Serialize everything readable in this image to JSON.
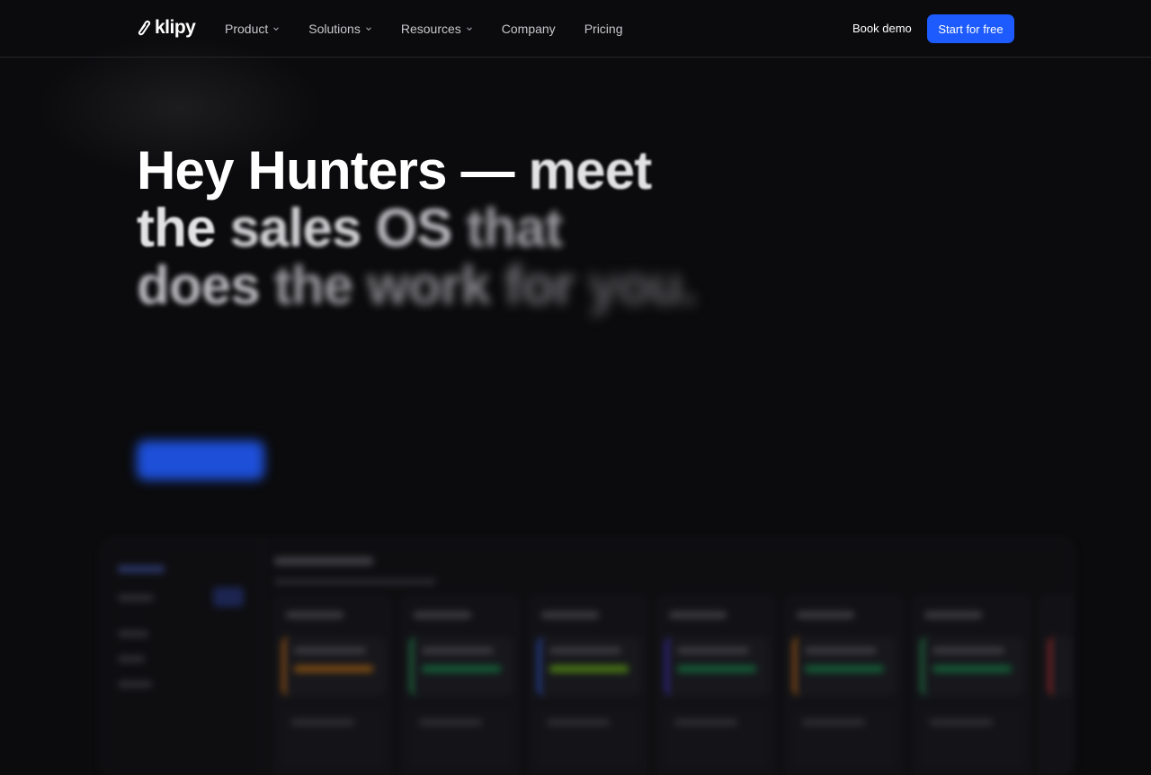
{
  "nav": {
    "logo_text": "klipy",
    "menu": [
      {
        "label": "Product",
        "has_dropdown": true
      },
      {
        "label": "Solutions",
        "has_dropdown": true
      },
      {
        "label": "Resources",
        "has_dropdown": true
      },
      {
        "label": "Company",
        "has_dropdown": false
      },
      {
        "label": "Pricing",
        "has_dropdown": false
      }
    ],
    "book_demo": "Book demo",
    "start_free": "Start for free"
  },
  "hero": {
    "line1": [
      "Hey",
      "Hunters",
      "—",
      "meet"
    ],
    "line2": [
      "the",
      "sales",
      "OS",
      "that"
    ],
    "line3": [
      "does",
      "the",
      "work",
      "for",
      "you."
    ]
  },
  "colors": {
    "background": "#0b0b0d",
    "accent": "#1d5bff",
    "nav_text": "#c8c8cc"
  },
  "icons": {
    "logo": "klipy-logo-icon",
    "dropdown": "chevron-down-icon"
  }
}
